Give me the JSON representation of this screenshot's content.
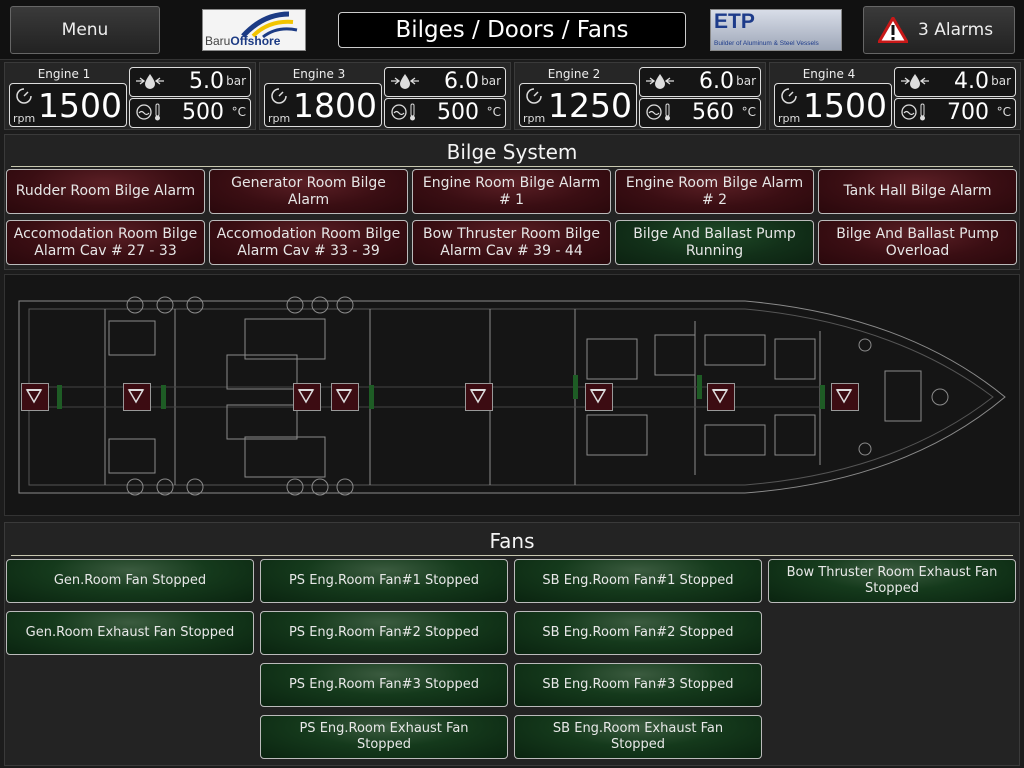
{
  "header": {
    "menu_label": "Menu",
    "title": "Bilges / Doors / Fans",
    "logo_left": {
      "part1": "Baru",
      "part2": "Offshore"
    },
    "logo_right": {
      "name": "ETP",
      "tagline": "Builder of Aluminum & Steel Vessels"
    },
    "alarms_label": "3 Alarms"
  },
  "engines": [
    {
      "name": "Engine 1",
      "rpm": "1500",
      "rpm_unit": "rpm",
      "pressure": "5.0",
      "pressure_unit": "bar",
      "temp": "500",
      "temp_unit": "°C"
    },
    {
      "name": "Engine 3",
      "rpm": "1800",
      "rpm_unit": "rpm",
      "pressure": "6.0",
      "pressure_unit": "bar",
      "temp": "500",
      "temp_unit": "°C"
    },
    {
      "name": "Engine 2",
      "rpm": "1250",
      "rpm_unit": "rpm",
      "pressure": "6.0",
      "pressure_unit": "bar",
      "temp": "560",
      "temp_unit": "°C"
    },
    {
      "name": "Engine 4",
      "rpm": "1500",
      "rpm_unit": "rpm",
      "pressure": "4.0",
      "pressure_unit": "bar",
      "temp": "700",
      "temp_unit": "°C"
    }
  ],
  "bilge": {
    "title": "Bilge System",
    "buttons": [
      {
        "label": "Rudder Room Bilge Alarm",
        "state": "red"
      },
      {
        "label": "Generator Room Bilge Alarm",
        "state": "red"
      },
      {
        "label": "Engine Room Bilge Alarm # 1",
        "state": "red"
      },
      {
        "label": "Engine Room Bilge Alarm # 2",
        "state": "red"
      },
      {
        "label": "Tank Hall Bilge Alarm",
        "state": "red"
      },
      {
        "label": "Accomodation Room Bilge Alarm Cav # 27 - 33",
        "state": "red"
      },
      {
        "label": "Accomodation Room Bilge Alarm Cav # 33 - 39",
        "state": "red"
      },
      {
        "label": "Bow Thruster Room Bilge Alarm Cav # 39 - 44",
        "state": "red"
      },
      {
        "label": "Bilge And Ballast Pump Running",
        "state": "green"
      },
      {
        "label": "Bilge And Ballast Pump Overload",
        "state": "red"
      }
    ]
  },
  "colors": {
    "alarm_red": "#3a0e13",
    "running_green": "#123019",
    "fan_green": "#153a1c"
  },
  "fans": {
    "title": "Fans",
    "buttons": [
      "Gen.Room Fan Stopped",
      "PS Eng.Room Fan#1 Stopped",
      "SB Eng.Room Fan#1 Stopped",
      "Bow Thruster Room Exhaust Fan Stopped",
      "Gen.Room Exhaust Fan Stopped",
      "PS Eng.Room Fan#2 Stopped",
      "SB Eng.Room Fan#2 Stopped",
      "PS Eng.Room Fan#3 Stopped",
      "SB Eng.Room Fan#3 Stopped",
      "PS Eng.Room Exhaust Fan Stopped",
      "SB Eng.Room Exhaust Fan Stopped"
    ]
  }
}
